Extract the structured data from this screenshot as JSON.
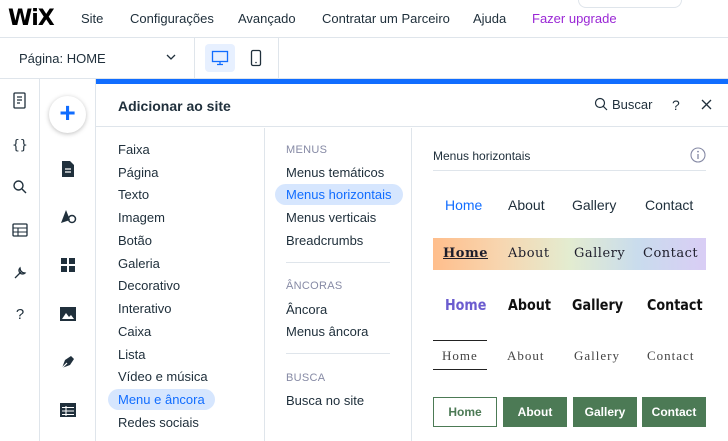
{
  "topbar": {
    "logo": "WiX",
    "menu": [
      "Site",
      "Configurações",
      "Avançado",
      "Contratar um Parceiro",
      "Ajuda",
      "Fazer upgrade"
    ],
    "nub_glyph": "ˆ"
  },
  "pagebar": {
    "page_label": "Página: HOME",
    "devices": [
      "desktop-icon",
      "mobile-icon"
    ],
    "active_device": "desktop"
  },
  "rail1_icons": [
    "pages-icon",
    "code-icon",
    "search-icon",
    "database-icon",
    "tools-icon",
    "help-icon"
  ],
  "rail1_help": "?",
  "rail2": {
    "add_label": "+",
    "icons": [
      "page-icon",
      "design-icon",
      "apps-icon",
      "media-icon",
      "blog-icon",
      "table-icon"
    ]
  },
  "panel": {
    "title": "Adicionar ao site",
    "search_label": "Buscar",
    "help": "?",
    "categories": [
      "Faixa",
      "Página",
      "Texto",
      "Imagem",
      "Botão",
      "Galeria",
      "Decorativo",
      "Interativo",
      "Caixa",
      "Lista",
      "Vídeo e música",
      "Menu e âncora",
      "Redes sociais"
    ],
    "active_category": "Menu e âncora",
    "sections": [
      {
        "heading": "MENUS",
        "items": [
          "Menus temáticos",
          "Menus horizontais",
          "Menus verticais",
          "Breadcrumbs"
        ]
      },
      {
        "heading": "ÂNCORAS",
        "items": [
          "Âncora",
          "Menus âncora"
        ]
      },
      {
        "heading": "BUSCA",
        "items": [
          "Busca no site"
        ]
      }
    ],
    "active_item": "Menus horizontais",
    "preview": {
      "title": "Menus horizontais",
      "menus": [
        [
          "Home",
          "About",
          "Gallery",
          "Contact"
        ],
        [
          "Home",
          "About",
          "Gallery",
          "Contact"
        ],
        [
          "Home",
          "About",
          "Gallery",
          "Contact"
        ],
        [
          "Home",
          "About",
          "Gallery",
          "Contact"
        ],
        [
          "Home",
          "About",
          "Gallery",
          "Contact"
        ]
      ]
    }
  },
  "colors": {
    "accent": "#116dff",
    "upgrade": "#9a27d5",
    "green": "#4c7a55",
    "active_bg": "#d6e6fe"
  }
}
